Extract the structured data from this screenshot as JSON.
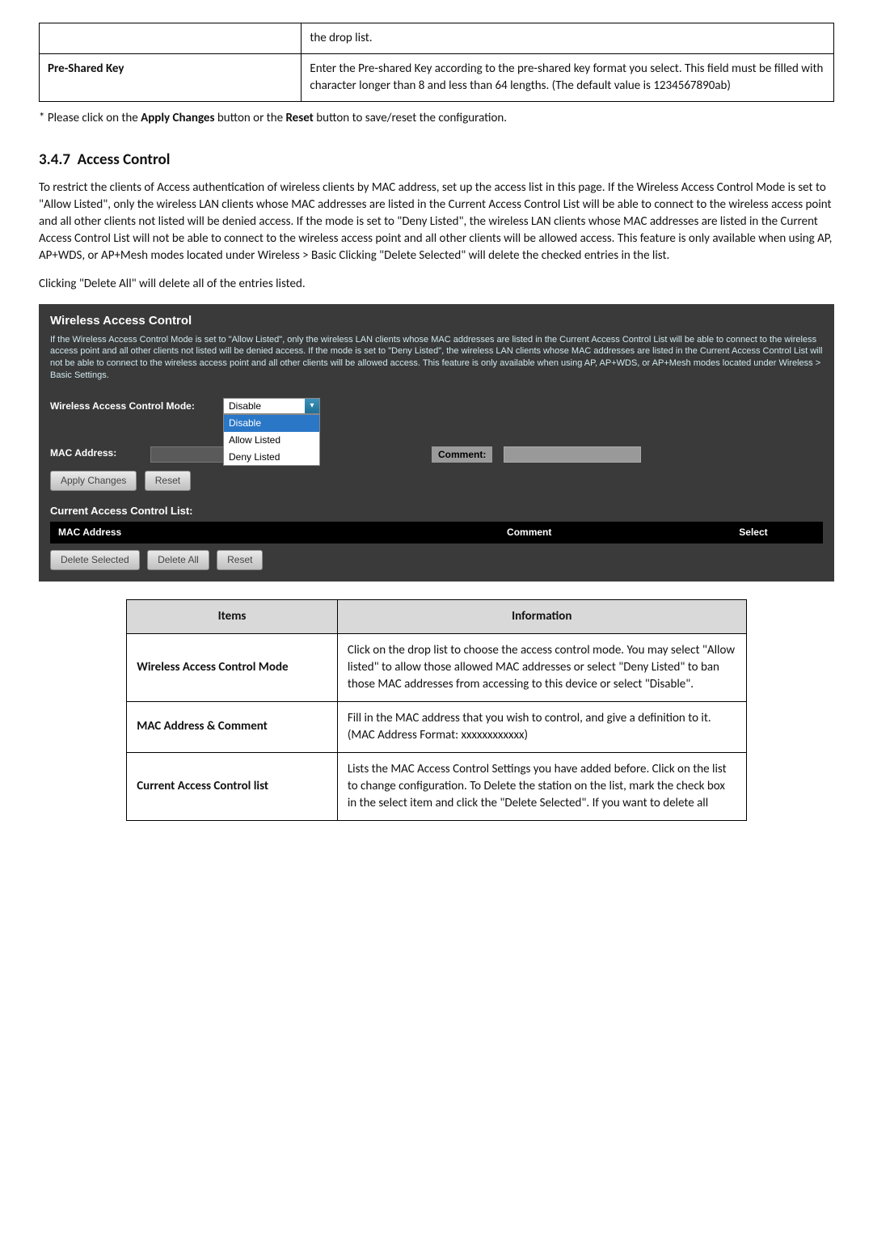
{
  "top_table": {
    "rows": [
      {
        "label": "",
        "value": "the drop list."
      },
      {
        "label": "Pre-Shared Key",
        "value": "Enter the Pre-shared Key according to the pre-shared key format you select. This field must be filled with character longer than 8 and less than 64 lengths. (The default value is 1234567890ab)"
      }
    ]
  },
  "apply_note": "* Please click on the Apply Changes button or the Reset button to save/reset the configuration.",
  "section_no": "3.4.7",
  "section_title": "Access Control",
  "body_p1": "To restrict the clients of Access authentication of wireless clients by MAC address, set up the access list in this page. If the Wireless Access Control Mode is set to \"Allow Listed\", only the wireless LAN clients whose MAC addresses are listed in the Current Access Control List will be able to connect to the wireless access point and all other clients not listed will be denied access. If the mode is set to \"Deny Listed\", the wireless LAN clients whose MAC addresses are listed in the Current Access Control List will not be able to connect to the wireless access point and all other clients will be allowed access. This feature is only available when using AP, AP+WDS, or AP+Mesh modes located under Wireless > Basic Clicking \"Delete Selected\" will delete the checked entries in the list.",
  "body_p2": "Clicking \"Delete All\" will delete all of the entries listed.",
  "app": {
    "title": "Wireless Access Control",
    "blurb": "If the Wireless Access Control Mode is set to \"Allow Listed\", only the wireless LAN clients whose MAC addresses are listed in the Current Access Control List will be able to connect to the wireless access point and all other clients not listed will be denied access. If the mode is set to \"Deny Listed\", the wireless LAN clients whose MAC addresses are listed in the Current Access Control List will not be able to connect to the wireless access point and all other clients will be allowed access. This feature is only available when using AP, AP+WDS, or AP+Mesh modes located under Wireless > Basic Settings.",
    "mode_label": "Wireless Access Control Mode:",
    "mode_value": "Disable",
    "mode_options": [
      "Disable",
      "Allow Listed",
      "Deny Listed"
    ],
    "mac_label": "MAC Address:",
    "comment_label": "Comment:",
    "apply_btn": "Apply Changes",
    "reset_btn": "Reset",
    "list_title": "Current Access Control List:",
    "cols": {
      "mac": "MAC Address",
      "comment": "Comment",
      "select": "Select"
    },
    "delete_selected": "Delete Selected",
    "delete_all": "Delete All",
    "reset2": "Reset"
  },
  "items_table": {
    "header": {
      "items": "Items",
      "info": "Information"
    },
    "rows": [
      {
        "label": "Wireless Access Control Mode",
        "value": "Click on the drop list to choose the access control mode. You may select \"Allow listed\" to allow those allowed MAC addresses or select \"Deny Listed\" to ban those MAC addresses from accessing to this device or select \"Disable\"."
      },
      {
        "label": "MAC Address & Comment",
        "value": "Fill in the MAC address that you wish to control, and give a definition to it.\n(MAC Address Format: xxxxxxxxxxxx)"
      },
      {
        "label": "Current Access Control list",
        "value": "Lists the MAC Access Control Settings you have added before. Click on the list to change configuration. To Delete the station on the list, mark the check box in the select item and click the \"Delete Selected\". If you want to delete all"
      }
    ]
  }
}
